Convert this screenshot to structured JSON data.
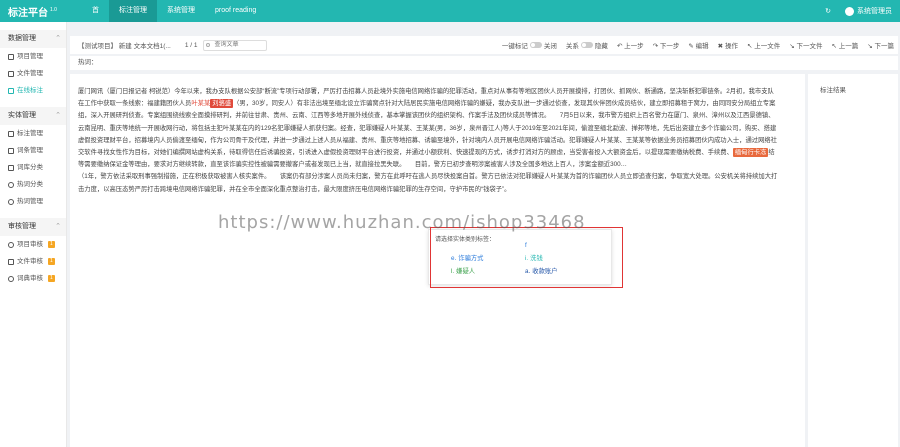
{
  "header": {
    "logo": "标注平台",
    "version": "1.0",
    "nav": [
      "首",
      "标注管理",
      "系统管理",
      "proof reading"
    ],
    "active_nav": 1,
    "user": "系统管理员"
  },
  "sidebar": {
    "groups": [
      {
        "label": "数据管理",
        "items": [
          {
            "label": "项目管理"
          },
          {
            "label": "文件管理"
          },
          {
            "label": "在线标注"
          }
        ]
      },
      {
        "label": "实体管理",
        "items": [
          {
            "label": "标注管理"
          },
          {
            "label": "词条管理"
          },
          {
            "label": "词库分类"
          },
          {
            "label": "热词分类"
          },
          {
            "label": "热词管理"
          }
        ]
      },
      {
        "label": "审核管理",
        "items": [
          {
            "label": "项目审核",
            "badge": "1"
          },
          {
            "label": "文件审核",
            "badge": "1"
          },
          {
            "label": "词典审核",
            "badge": "1"
          }
        ]
      }
    ]
  },
  "toolbar": {
    "breadcrumb": "【测试项目】 新建 文本文档1(...",
    "pager": "1 / 1",
    "search_placeholder": "查询文章",
    "one_click_label": "一键标记",
    "one_click_state": "关闭",
    "relation_label": "关系",
    "relation_state": "隐藏",
    "buttons": [
      "上一步",
      "下一步",
      "编辑",
      "操作",
      "上一文件",
      "下一文件",
      "上一篇",
      "下一篇"
    ]
  },
  "hotwords": {
    "label": "热词："
  },
  "document": {
    "segments": [
      {
        "t": "厦门网讯（厦门日报记者 柯锐范）今年以来，我办支队根据公安部“断流”专项行动部署，严厉打击招募人员赴境外实施电信网络诈骗的犯罪活动，重点对从事有等地区团伙人员开展摸排，打团伙、抓网伙、断通路，坚决斩断犯罪链条。2月初，我市支队在工作中获取一条线索：福建籍团伙人员"
      },
      {
        "t": "叶某某",
        "cls": "hl-red"
      },
      {
        "t": "刘骆盛",
        "tag": "red"
      },
      {
        "t": "（男，30岁，同安人）有非法出境至缅北设立诈骗窝点针对大陆居民实施电信网络诈骗的嫌疑，我办支队进一步通过侦查，发现其伙伴团伙成员结伙，建立即招募租于窝力，由同同安分局组立专案组，深入开展研判侦查。专案组围绕线索全面摸排研判，并前往甘肃、贵州、云南、江西等多地开展外线侦查，基本掌握该团伙的组织架构、作案手法及团伙成员等情况。　　7月5日以来，我市警方组织上百名警力在厦门、泉州、漳州以及江西景德镇、云南昆明、重庆等地统一开展收网行动，将包括主犯叶某某在内的129名犯罪嫌疑人抓获归案。经查，犯罪嫌疑人叶某某、王某某(男，36岁，泉州晋江人)等人于2019年至2021年间，偷渡至缅北勐波、掸邦等地，先后出资建立多个诈骗公司，购买、搭建虚假投资理财平台，招募境内人员偷渡至缅甸，作为公司骨干及代理，并进一步通过上述人员从福建、贵州、重庆等地招募、诱骗至境外，针对境内人员开展电信网络诈骗活动。犯罪嫌疑人叶某某、王某某等依据业务员招募团伙内成功入士，通过网络社交软件寻找女性作为目标，对她们编撰网站虚构关系，待取得信任后诱骗投资，引诱进入虚假投资理财平台进行投资，并通过小额获利、快速提现的方式，诱步打消对方的顾虑，当受害者投入大额资金后，以提现需要缴纳税费、手续费、"
      },
      {
        "t": "缅甸行卡冻",
        "tag": "orange"
      },
      {
        "t": "结等需要缴纳保证金等理由，要求对方继续转款，直至该诈骗实控性被骗需要撤客户或者发现已上当，就直接拉黑失联。　　目前，警方已初步查明涉案被害人涉及全国多地达上百人，涉案金额近300"
      },
      {
        "t": "…　　　　　　　　　　　　　　　　　　　　　　　　　　　　　　　　　　　　　（1年，警方依法采取刑事强制措施，正在积极获取被害人核实案件。　　该案仍有部分涉案人员尚未归案，警方在此呼吁在逃人员尽快投案自首。警方已依法对犯罪嫌疑人叶某某为首的诈骗团伙人员立即追查归案，争取宽大处理。公安机关将持续加大打击力度，以高压态势严厉打击跨境电信网络诈骗犯罪，并在全市全面深化重点整治打击，最大限度挤压电信网络诈骗犯罪的生存空间，守护市民的“钱袋子”。"
      }
    ]
  },
  "popup": {
    "title": "请选择实体类别标签：",
    "options": [
      {
        "key": "",
        "label": "",
        "color": "#e04a3b"
      },
      {
        "key": "f",
        "label": "",
        "color": "#2b7bdb"
      },
      {
        "key": "e.",
        "label": "诈骗方式",
        "color": "#2b7bdb"
      },
      {
        "key": "i.",
        "label": "洗钱",
        "color": "#23b7b1"
      },
      {
        "key": "l.",
        "label": "嫌疑人",
        "color": "#3aa04a"
      },
      {
        "key": "a.",
        "label": "收款账户",
        "color": "#2456a8"
      }
    ]
  },
  "label_panel": {
    "title": "标注结果"
  },
  "watermarks": [
    "https://www.huzhan.com/ishop33468"
  ]
}
